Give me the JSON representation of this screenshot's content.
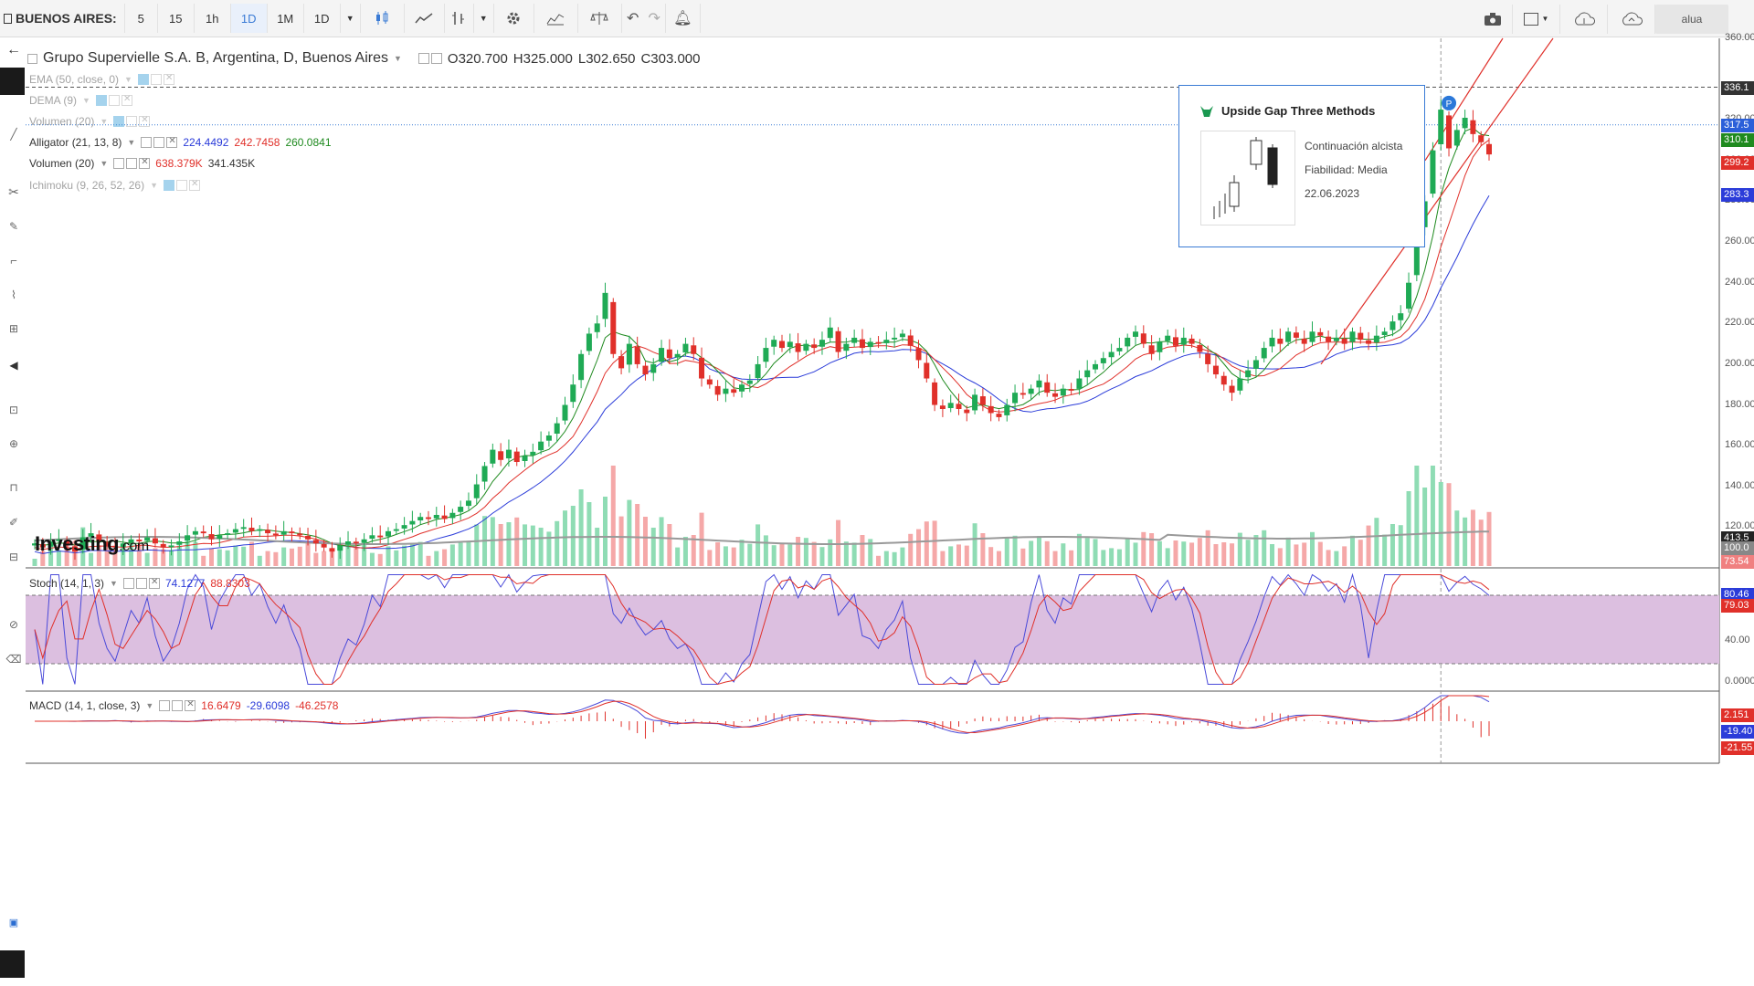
{
  "toolbar": {
    "ticker": "BUENOS AIRES:",
    "intervals": [
      "5",
      "15",
      "1h",
      "1D",
      "1M",
      "1D"
    ],
    "active_interval_index": 3,
    "user": "alua"
  },
  "header": {
    "symbol_title": "Grupo Supervielle S.A. B, Argentina, D, Buenos Aires",
    "open": "O320.700",
    "high": "H325.000",
    "low": "L302.650",
    "close": "C303.000"
  },
  "indicators": [
    {
      "label": "EMA (50, close, 0)",
      "faded": true
    },
    {
      "label": "DEMA (9)",
      "faded": true
    },
    {
      "label": "Volumen (20)",
      "faded": true
    },
    {
      "label": "Alligator (21, 13, 8)",
      "faded": false,
      "values": [
        {
          "v": "224.4492",
          "c": "#2b3cd9"
        },
        {
          "v": "242.7458",
          "c": "#e0302a"
        },
        {
          "v": "260.0841",
          "c": "#1f8a1f"
        }
      ]
    },
    {
      "label": "Volumen (20)",
      "faded": false,
      "values": [
        {
          "v": "638.379K",
          "c": "#e0302a"
        },
        {
          "v": "341.435K",
          "c": "#333333"
        }
      ]
    },
    {
      "label": "Ichimoku (9, 26, 52, 26)",
      "faded": true
    }
  ],
  "stoch": {
    "label": "Stoch (14, 1, 3)",
    "values": [
      {
        "v": "74.1277",
        "c": "#2b3cd9"
      },
      {
        "v": "88.8303",
        "c": "#e0302a"
      }
    ]
  },
  "macd": {
    "label": "MACD (14, 1, close, 3)",
    "values": [
      {
        "v": "16.6479",
        "c": "#e0302a"
      },
      {
        "v": "-29.6098",
        "c": "#2b3cd9"
      },
      {
        "v": "-46.2578",
        "c": "#e0302a"
      }
    ]
  },
  "pattern_popup": {
    "title": "Upside Gap Three Methods",
    "line1": "Continuación alcista",
    "line2": "Fiabilidad: Media",
    "date": "22.06.2023"
  },
  "logo": {
    "main": "Investing",
    "suffix": ".com"
  },
  "marker": "P",
  "chart_data": {
    "type": "candlestick",
    "price_axis": {
      "min": 100,
      "max": 360,
      "ticks": [
        "360.00",
        "320.00",
        "300.00",
        "280.00",
        "260.00",
        "240.00",
        "220.00",
        "200.00",
        "180.00",
        "160.00",
        "140.00",
        "120.00"
      ]
    },
    "price_tags": [
      {
        "v": "336.1",
        "c": "#333333",
        "price": 336
      },
      {
        "v": "317.5",
        "c": "#2b5fd9",
        "price": 317.5
      },
      {
        "v": "310.1",
        "c": "#1f8a1f",
        "price": 310.1
      },
      {
        "v": "299.2",
        "c": "#e0302a",
        "price": 299.2
      },
      {
        "v": "283.3",
        "c": "#2b3cd9",
        "price": 283.3
      },
      {
        "v": "413.5",
        "c": "#222222",
        "price": 115
      },
      {
        "v": "100.0",
        "c": "#888888",
        "price": 110
      },
      {
        "v": "73.54",
        "c": "#f08080",
        "price": 103
      }
    ],
    "stoch_axis": {
      "ticks": [
        "40.00",
        "0.0000"
      ]
    },
    "stoch_tags": [
      {
        "v": "80.46",
        "c": "#2b3cd9",
        "val": 80.46
      },
      {
        "v": "79.03",
        "c": "#e0302a",
        "val": 79.03
      }
    ],
    "macd_tags": [
      {
        "v": "2.151",
        "c": "#e0302a",
        "val": 2.151
      },
      {
        "v": "-19.40",
        "c": "#2b3cd9",
        "val": -19.4
      },
      {
        "v": "-21.55",
        "c": "#e0302a",
        "val": -21.55
      }
    ],
    "closes": [
      112,
      110,
      113,
      114,
      111,
      108,
      115,
      117,
      113,
      111,
      110,
      112,
      114,
      113,
      115,
      112,
      110,
      111,
      113,
      116,
      118,
      117,
      114,
      116,
      117,
      119,
      120,
      118,
      119,
      117,
      116,
      118,
      117,
      116,
      114,
      112,
      110,
      108,
      111,
      113,
      112,
      114,
      116,
      115,
      118,
      119,
      121,
      123,
      125,
      124,
      126,
      124,
      127,
      130,
      133,
      141,
      150,
      158,
      153,
      158,
      152,
      155,
      157,
      162,
      165,
      171,
      180,
      190,
      205,
      215,
      220,
      235,
      205,
      198,
      210,
      200,
      195,
      200,
      208,
      203,
      205,
      210,
      205,
      193,
      190,
      185,
      188,
      186,
      190,
      192,
      200,
      208,
      212,
      208,
      211,
      206,
      210,
      208,
      212,
      218,
      206,
      210,
      213,
      208,
      211,
      210,
      212,
      213,
      215,
      209,
      202,
      193,
      180,
      178,
      181,
      178,
      176,
      185,
      180,
      176,
      174,
      180,
      186,
      185,
      188,
      192,
      186,
      184,
      188,
      187,
      193,
      197,
      200,
      203,
      206,
      208,
      213,
      216,
      210,
      205,
      211,
      214,
      209,
      213,
      210,
      206,
      200,
      195,
      190,
      186,
      193,
      197,
      202,
      208,
      213,
      210,
      216,
      213,
      210,
      216,
      214,
      211,
      213,
      210,
      216,
      212,
      210,
      214,
      216,
      221,
      225,
      240,
      265,
      280,
      305,
      325,
      306,
      315,
      321,
      313,
      309,
      303
    ]
  }
}
